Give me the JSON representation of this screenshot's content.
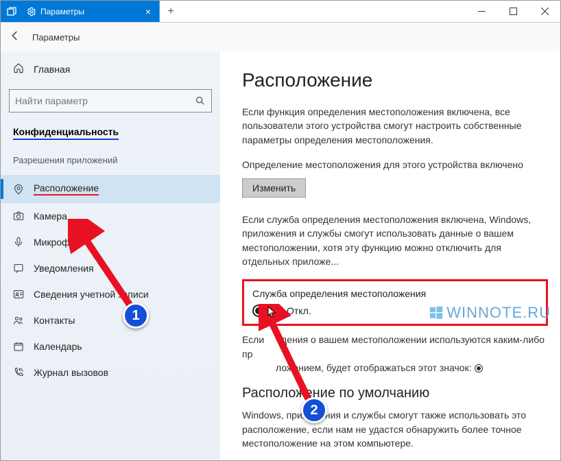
{
  "titlebar": {
    "tab_label": "Параметры",
    "new_tab": "+"
  },
  "header": {
    "breadcrumb": "Параметры"
  },
  "sidebar": {
    "home": "Главная",
    "search_placeholder": "Найти параметр",
    "section_title": "Конфиденциальность",
    "subheading": "Разрешения приложений",
    "items": [
      {
        "label": "Расположение",
        "icon": "location-icon",
        "active": true,
        "red": true
      },
      {
        "label": "Камера",
        "icon": "camera-icon"
      },
      {
        "label": "Микрофон",
        "icon": "microphone-icon"
      },
      {
        "label": "Уведомления",
        "icon": "notifications-icon"
      },
      {
        "label": "Сведения учетной записи",
        "icon": "account-info-icon"
      },
      {
        "label": "Контакты",
        "icon": "contacts-icon"
      },
      {
        "label": "Календарь",
        "icon": "calendar-icon"
      },
      {
        "label": "Журнал вызовов",
        "icon": "call-history-icon"
      }
    ]
  },
  "content": {
    "title": "Расположение",
    "para1": "Если функция определения местоположения включена, все пользователи этого устройства смогут настроить собственные параметры определения местоположения.",
    "status_line": "Определение местоположения для этого устройства включено",
    "change_btn": "Изменить",
    "para2": "Если служба определения местоположения включена, Windows, приложения и службы смогут использовать данные о вашем местоположении, хотя эту функцию можно отключить для отдельных приложе...",
    "toggle_label": "Служба определения местоположения",
    "toggle_state": "Откл.",
    "para3_prefix": "Если ",
    "para3_mid": "дения о вашем местоположении используются каким-либо пр",
    "para3_suffix": "ложением, будет отображаться этот значок: ",
    "section2": "Расположение по умолчанию",
    "para4": "Windows, приложения и службы смогут также использовать это расположение, если нам не удастся обнаружить более точное местоположение на этом компьютере."
  },
  "watermark": {
    "text": "WINNOTE.RU"
  },
  "annotations": {
    "badge1": "1",
    "badge2": "2"
  }
}
